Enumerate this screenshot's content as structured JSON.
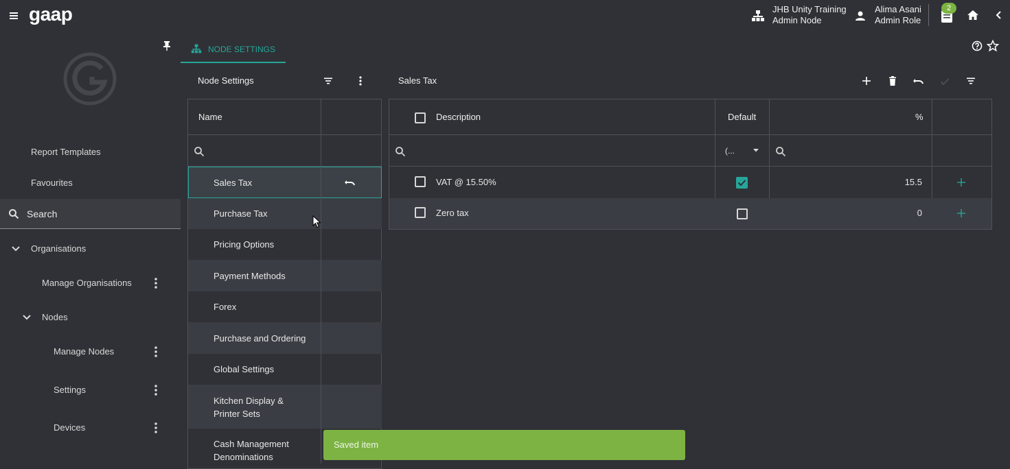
{
  "header": {
    "logo": "gaap",
    "node_line1": "JHB Unity Training",
    "node_line2": "Admin Node",
    "user_line1": "Alima Asani",
    "user_line2": "Admin Role",
    "notification_count": "2"
  },
  "sidebar": {
    "report_templates": "Report Templates",
    "favourites": "Favourites",
    "search_label": "Search",
    "organisations": "Organisations",
    "manage_organisations": "Manage Organisations",
    "nodes": "Nodes",
    "manage_nodes": "Manage Nodes",
    "settings": "Settings",
    "devices": "Devices"
  },
  "tab": {
    "label": "NODE SETTINGS"
  },
  "left_panel": {
    "title": "Node Settings",
    "column_name": "Name",
    "items": [
      "Sales Tax",
      "Purchase Tax",
      "Pricing Options",
      "Payment Methods",
      "Forex",
      "Purchase and Ordering",
      "Global Settings",
      "Kitchen Display & Printer Sets",
      "Cash Management Denominations"
    ]
  },
  "right_panel": {
    "title": "Sales Tax",
    "col_description": "Description",
    "col_default": "Default",
    "col_percent": "%",
    "default_filter": "(...",
    "rows": [
      {
        "description": "VAT @ 15.50%",
        "default": true,
        "percent": "15.5"
      },
      {
        "description": "Zero tax",
        "default": false,
        "percent": "0"
      }
    ]
  },
  "toast": {
    "message": "Saved item"
  },
  "colors": {
    "accent": "#26a69a",
    "toast": "#7cb342",
    "background": "#2f3136"
  }
}
